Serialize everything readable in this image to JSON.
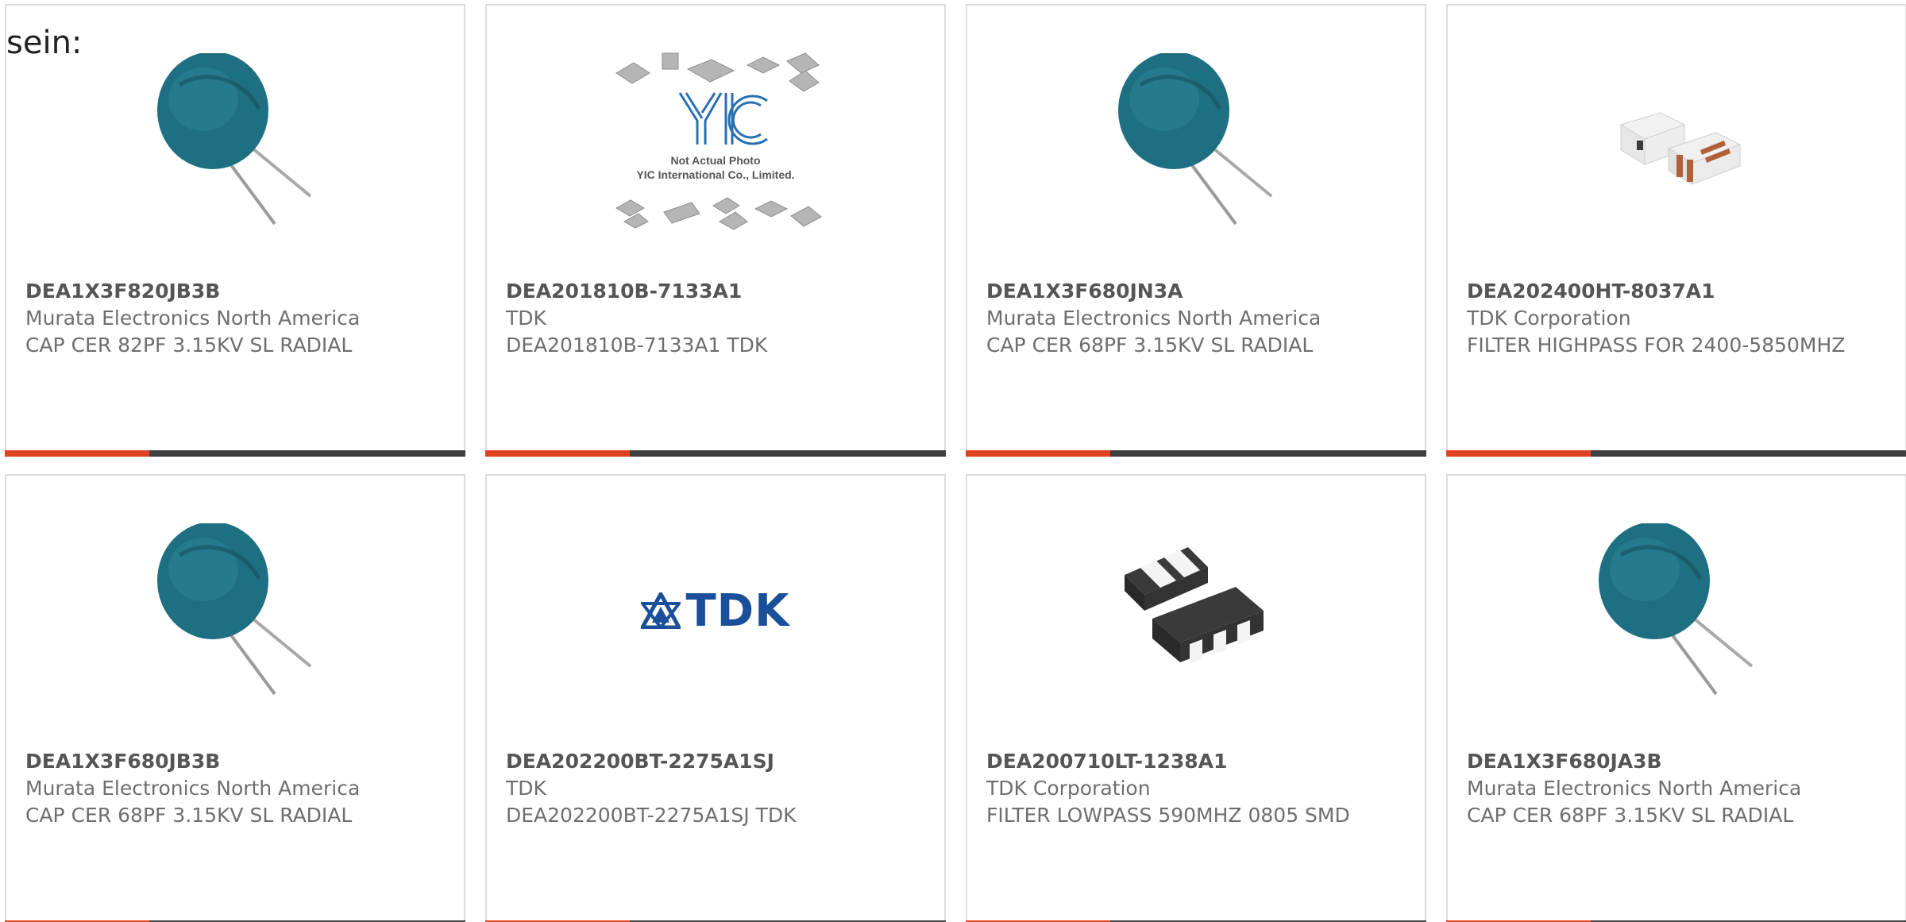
{
  "intro": {
    "text": "sein:"
  },
  "products": [
    {
      "part_number": "DEA1X3F820JB3B",
      "manufacturer": "Murata Electronics North America",
      "description": "CAP CER 82PF 3.15KV SL RADIAL",
      "image": "radial-disc-capacitor-icon"
    },
    {
      "part_number": "DEA201810B-7133A1",
      "manufacturer": "TDK",
      "description": "DEA201810B-7133A1 TDK",
      "image": "placeholder-not-actual-photo-icon",
      "placeholder_caption_line1": "Not Actual Photo",
      "placeholder_caption_line2": "YIC International Co., Limited.",
      "placeholder_logo": "YIC"
    },
    {
      "part_number": "DEA1X3F680JN3A",
      "manufacturer": "Murata Electronics North America",
      "description": "CAP CER 68PF 3.15KV SL RADIAL",
      "image": "radial-disc-capacitor-icon"
    },
    {
      "part_number": "DEA202400HT-8037A1",
      "manufacturer": "TDK Corporation",
      "description": "FILTER HIGHPASS FOR 2400-5850MHZ",
      "image": "smd-filter-chip-icon"
    },
    {
      "part_number": "DEA1X3F680JB3B",
      "manufacturer": "Murata Electronics North America",
      "description": "CAP CER 68PF 3.15KV SL RADIAL",
      "image": "radial-disc-capacitor-icon"
    },
    {
      "part_number": "DEA202200BT-2275A1SJ",
      "manufacturer": "TDK",
      "description": "DEA202200BT-2275A1SJ TDK",
      "image": "tdk-logo-icon",
      "logo_text": "TDK"
    },
    {
      "part_number": "DEA200710LT-1238A1",
      "manufacturer": "TDK Corporation",
      "description": "FILTER LOWPASS 590MHZ 0805 SMD",
      "image": "smd-lowpass-filter-icon"
    },
    {
      "part_number": "DEA1X3F680JA3B",
      "manufacturer": "Murata Electronics North America",
      "description": "CAP CER 68PF 3.15KV SL RADIAL",
      "image": "radial-disc-capacitor-icon"
    }
  ],
  "colors": {
    "accent": "#e0431f",
    "bar": "#3f3f3f",
    "border": "#dcdcdc",
    "text": "#6e6e6e",
    "capacitor": "#1f6f82",
    "tdk_blue": "#1a4f9a"
  }
}
